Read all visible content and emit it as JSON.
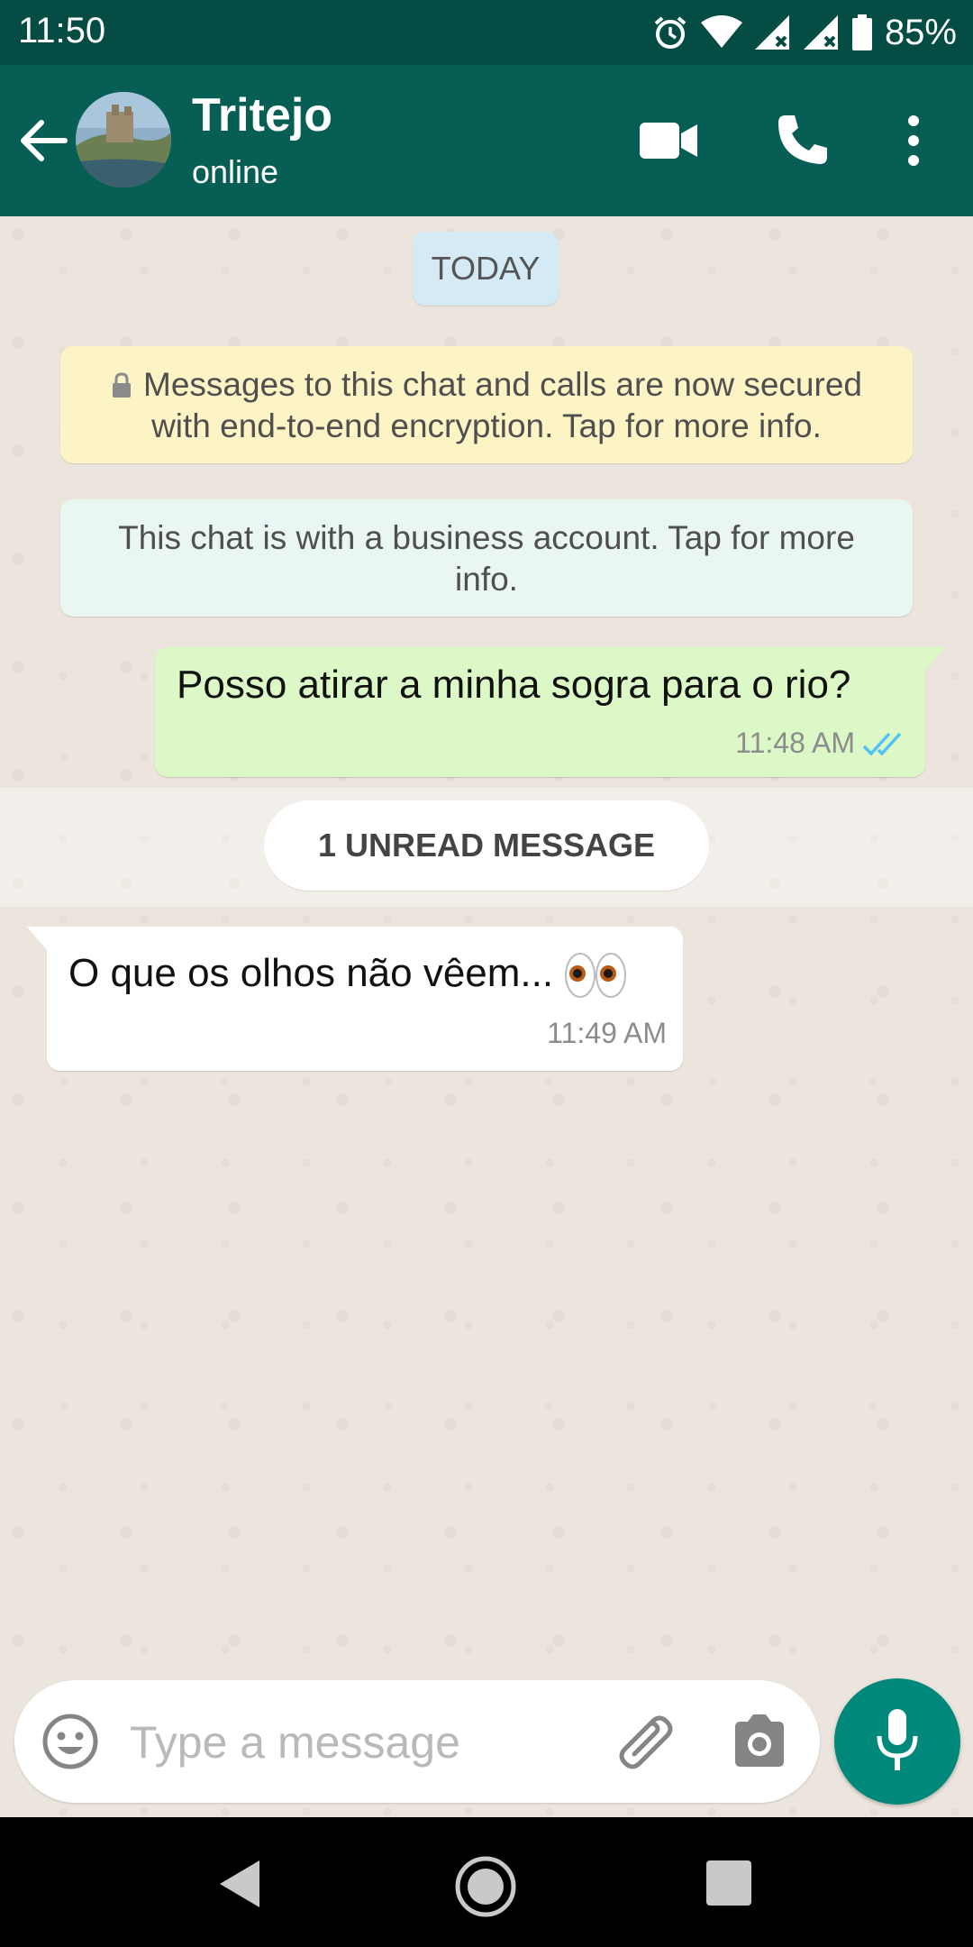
{
  "status_bar": {
    "time": "11:50",
    "battery": "85%",
    "icons": [
      "alarm-icon",
      "wifi-icon",
      "signal-icon",
      "signal-icon",
      "battery-icon"
    ]
  },
  "header": {
    "contact_name": "Tritejo",
    "contact_status": "online",
    "icons": [
      "back-arrow-icon",
      "video-call-icon",
      "phone-icon",
      "more-vert-icon"
    ]
  },
  "chat": {
    "date_chip": "TODAY",
    "encryption_notice": "Messages to this chat and calls are now secured with end-to-end encryption. Tap for more info.",
    "business_notice": "This chat is with a business account. Tap for more info.",
    "unread_divider": "1 UNREAD MESSAGE",
    "messages": [
      {
        "direction": "outgoing",
        "text": "Posso atirar a minha sogra para o rio?",
        "time": "11:48 AM",
        "status": "read"
      },
      {
        "direction": "incoming",
        "text": "O que os olhos não vêem...",
        "emoji": "eyes",
        "time": "11:49 AM"
      }
    ]
  },
  "composer": {
    "placeholder": "Type a message",
    "value": ""
  },
  "colors": {
    "header": "#075e54",
    "status_bar": "#054d44",
    "outgoing_bubble": "#dcf8c6",
    "read_ticks": "#4fc3f7",
    "mic_button": "#00897b"
  }
}
